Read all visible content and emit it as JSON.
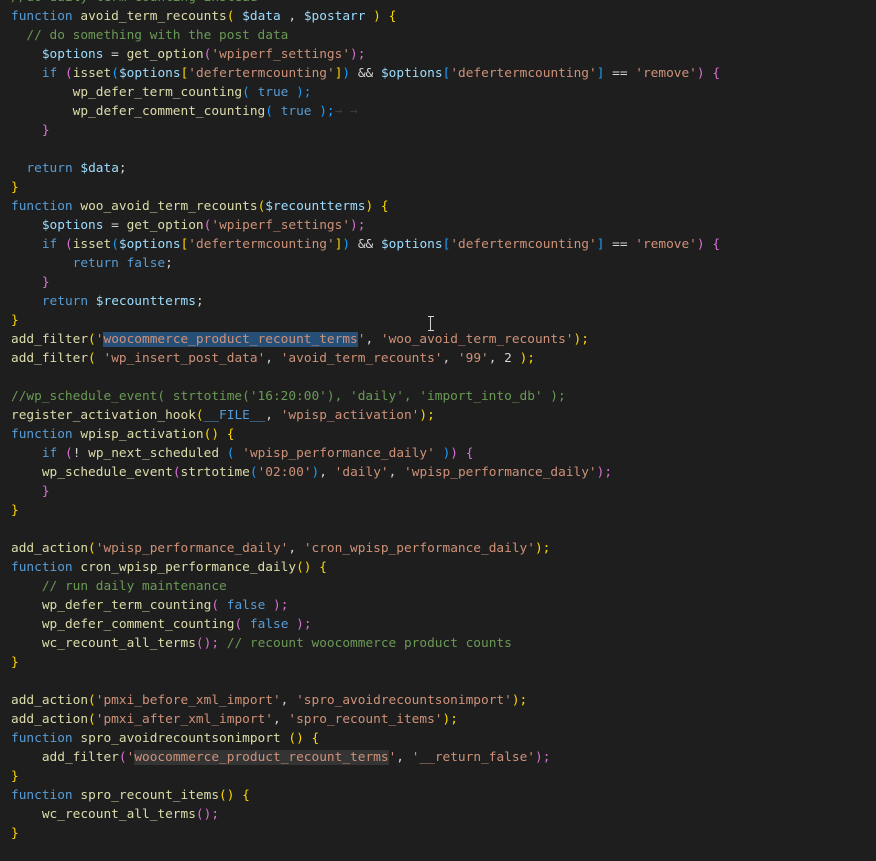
{
  "editor": {
    "colors": {
      "background": "#1e1e1e",
      "keyword": "#569cd6",
      "function": "#dcdcaa",
      "variable": "#9cdcfe",
      "string": "#ce9178",
      "comment": "#6a9955",
      "selection": "#264f78"
    },
    "cursor_icon": "text-cursor-ibeam-icon",
    "lines": [
      [
        {
          "t": "//do daily term counting instead",
          "c": "cm"
        }
      ],
      [
        {
          "t": "function",
          "c": "kw"
        },
        {
          "t": " ",
          "c": "pl"
        },
        {
          "t": "avoid_term_recounts",
          "c": "fn"
        },
        {
          "t": "( ",
          "c": "br"
        },
        {
          "t": "$data",
          "c": "var"
        },
        {
          "t": " , ",
          "c": "pl"
        },
        {
          "t": "$postarr",
          "c": "var"
        },
        {
          "t": " ) ",
          "c": "br"
        },
        {
          "t": "{",
          "c": "br"
        }
      ],
      [
        {
          "t": "  ",
          "c": "ws"
        },
        {
          "t": "// do something with the post data",
          "c": "cm"
        }
      ],
      [
        {
          "t": "    ",
          "c": "ws"
        },
        {
          "t": "$options",
          "c": "var"
        },
        {
          "t": " = ",
          "c": "pl"
        },
        {
          "t": "get_option",
          "c": "fn"
        },
        {
          "t": "(",
          "c": "br2"
        },
        {
          "t": "'wpiperf_settings'",
          "c": "str"
        },
        {
          "t": ");",
          "c": "br2"
        }
      ],
      [
        {
          "t": "    ",
          "c": "ws"
        },
        {
          "t": "if",
          "c": "kw"
        },
        {
          "t": " ",
          "c": "pl"
        },
        {
          "t": "(",
          "c": "br2"
        },
        {
          "t": "isset",
          "c": "fn"
        },
        {
          "t": "(",
          "c": "br3"
        },
        {
          "t": "$options",
          "c": "var"
        },
        {
          "t": "[",
          "c": "br"
        },
        {
          "t": "'defertermcounting'",
          "c": "str"
        },
        {
          "t": "]",
          "c": "br"
        },
        {
          "t": ")",
          "c": "br3"
        },
        {
          "t": " && ",
          "c": "pl"
        },
        {
          "t": "$options",
          "c": "var"
        },
        {
          "t": "[",
          "c": "br3"
        },
        {
          "t": "'defertermcounting'",
          "c": "str"
        },
        {
          "t": "]",
          "c": "br3"
        },
        {
          "t": " == ",
          "c": "pl"
        },
        {
          "t": "'remove'",
          "c": "str"
        },
        {
          "t": ")",
          "c": "br2"
        },
        {
          "t": " {",
          "c": "br2"
        }
      ],
      [
        {
          "t": "        ",
          "c": "ws"
        },
        {
          "t": "wp_defer_term_counting",
          "c": "fn"
        },
        {
          "t": "(",
          "c": "br3"
        },
        {
          "t": " true ",
          "c": "kw"
        },
        {
          "t": ");",
          "c": "br3"
        }
      ],
      [
        {
          "t": "        ",
          "c": "ws"
        },
        {
          "t": "wp_defer_comment_counting",
          "c": "fn"
        },
        {
          "t": "(",
          "c": "br3"
        },
        {
          "t": " true ",
          "c": "kw"
        },
        {
          "t": ");",
          "c": "br3"
        },
        {
          "t": "→ →",
          "c": "ws"
        }
      ],
      [
        {
          "t": "    ",
          "c": "ws"
        },
        {
          "t": "}",
          "c": "br2"
        }
      ],
      [
        {
          "t": " ",
          "c": "pl"
        }
      ],
      [
        {
          "t": "  ",
          "c": "ws"
        },
        {
          "t": "return",
          "c": "kw"
        },
        {
          "t": " ",
          "c": "pl"
        },
        {
          "t": "$data",
          "c": "var"
        },
        {
          "t": ";",
          "c": "pl"
        }
      ],
      [
        {
          "t": "}",
          "c": "br"
        }
      ],
      [
        {
          "t": "function",
          "c": "kw"
        },
        {
          "t": " ",
          "c": "pl"
        },
        {
          "t": "woo_avoid_term_recounts",
          "c": "fn"
        },
        {
          "t": "(",
          "c": "br"
        },
        {
          "t": "$recountterms",
          "c": "var"
        },
        {
          "t": ") ",
          "c": "br"
        },
        {
          "t": "{",
          "c": "br"
        }
      ],
      [
        {
          "t": "    ",
          "c": "ws"
        },
        {
          "t": "$options",
          "c": "var"
        },
        {
          "t": " = ",
          "c": "pl"
        },
        {
          "t": "get_option",
          "c": "fn"
        },
        {
          "t": "(",
          "c": "br2"
        },
        {
          "t": "'wpiperf_settings'",
          "c": "str"
        },
        {
          "t": ");",
          "c": "br2"
        }
      ],
      [
        {
          "t": "    ",
          "c": "ws"
        },
        {
          "t": "if",
          "c": "kw"
        },
        {
          "t": " ",
          "c": "pl"
        },
        {
          "t": "(",
          "c": "br2"
        },
        {
          "t": "isset",
          "c": "fn"
        },
        {
          "t": "(",
          "c": "br3"
        },
        {
          "t": "$options",
          "c": "var"
        },
        {
          "t": "[",
          "c": "br"
        },
        {
          "t": "'defertermcounting'",
          "c": "str"
        },
        {
          "t": "]",
          "c": "br"
        },
        {
          "t": ")",
          "c": "br3"
        },
        {
          "t": " && ",
          "c": "pl"
        },
        {
          "t": "$options",
          "c": "var"
        },
        {
          "t": "[",
          "c": "br3"
        },
        {
          "t": "'defertermcounting'",
          "c": "str"
        },
        {
          "t": "]",
          "c": "br3"
        },
        {
          "t": " == ",
          "c": "pl"
        },
        {
          "t": "'remove'",
          "c": "str"
        },
        {
          "t": ")",
          "c": "br2"
        },
        {
          "t": " {",
          "c": "br2"
        }
      ],
      [
        {
          "t": "        ",
          "c": "ws"
        },
        {
          "t": "return",
          "c": "kw"
        },
        {
          "t": " ",
          "c": "pl"
        },
        {
          "t": "false",
          "c": "kw"
        },
        {
          "t": ";",
          "c": "pl"
        }
      ],
      [
        {
          "t": "    ",
          "c": "ws"
        },
        {
          "t": "}",
          "c": "br2"
        }
      ],
      [
        {
          "t": "    ",
          "c": "ws"
        },
        {
          "t": "return",
          "c": "kw"
        },
        {
          "t": " ",
          "c": "pl"
        },
        {
          "t": "$recountterms",
          "c": "var"
        },
        {
          "t": ";",
          "c": "pl"
        }
      ],
      [
        {
          "t": "}",
          "c": "br"
        }
      ],
      [
        {
          "t": "add_filter",
          "c": "fn"
        },
        {
          "t": "(",
          "c": "br"
        },
        {
          "t": "'",
          "c": "str"
        },
        {
          "t": "woocommerce_product_recount_terms",
          "c": "sel"
        },
        {
          "t": "'",
          "c": "str"
        },
        {
          "t": ", ",
          "c": "pl"
        },
        {
          "t": "'woo_avoid_term_recounts'",
          "c": "str"
        },
        {
          "t": ");",
          "c": "br"
        }
      ],
      [
        {
          "t": "add_filter",
          "c": "fn"
        },
        {
          "t": "(",
          "c": "br"
        },
        {
          "t": " ",
          "c": "pl"
        },
        {
          "t": "'wp_insert_post_data'",
          "c": "str"
        },
        {
          "t": ", ",
          "c": "pl"
        },
        {
          "t": "'avoid_term_recounts'",
          "c": "str"
        },
        {
          "t": ", ",
          "c": "pl"
        },
        {
          "t": "'99'",
          "c": "str"
        },
        {
          "t": ", ",
          "c": "pl"
        },
        {
          "t": "2",
          "c": "pl"
        },
        {
          "t": " );",
          "c": "br"
        }
      ],
      [
        {
          "t": " ",
          "c": "pl"
        }
      ],
      [
        {
          "t": "//wp_schedule_event( strtotime('16:20:00'), 'daily', 'import_into_db' );",
          "c": "cm"
        }
      ],
      [
        {
          "t": "register_activation_hook",
          "c": "fn"
        },
        {
          "t": "(",
          "c": "br"
        },
        {
          "t": "__FILE__",
          "c": "kw"
        },
        {
          "t": ", ",
          "c": "pl"
        },
        {
          "t": "'wpisp_activation'",
          "c": "str"
        },
        {
          "t": ");",
          "c": "br"
        }
      ],
      [
        {
          "t": "function",
          "c": "kw"
        },
        {
          "t": " ",
          "c": "pl"
        },
        {
          "t": "wpisp_activation",
          "c": "fn"
        },
        {
          "t": "() ",
          "c": "br"
        },
        {
          "t": "{",
          "c": "br"
        }
      ],
      [
        {
          "t": "    ",
          "c": "ws"
        },
        {
          "t": "if",
          "c": "kw"
        },
        {
          "t": " ",
          "c": "pl"
        },
        {
          "t": "(",
          "c": "br2"
        },
        {
          "t": "! ",
          "c": "pl"
        },
        {
          "t": "wp_next_scheduled",
          "c": "fn"
        },
        {
          "t": " (",
          "c": "br3"
        },
        {
          "t": " ",
          "c": "pl"
        },
        {
          "t": "'wpisp_performance_daily'",
          "c": "str"
        },
        {
          "t": " )",
          "c": "br3"
        },
        {
          "t": ")",
          "c": "br2"
        },
        {
          "t": " {",
          "c": "br2"
        }
      ],
      [
        {
          "t": "    ",
          "c": "ws"
        },
        {
          "t": "wp_schedule_event",
          "c": "fn"
        },
        {
          "t": "(",
          "c": "br2"
        },
        {
          "t": "strtotime",
          "c": "fn"
        },
        {
          "t": "(",
          "c": "br3"
        },
        {
          "t": "'02:00'",
          "c": "str"
        },
        {
          "t": ")",
          "c": "br3"
        },
        {
          "t": ", ",
          "c": "pl"
        },
        {
          "t": "'daily'",
          "c": "str"
        },
        {
          "t": ", ",
          "c": "pl"
        },
        {
          "t": "'wpisp_performance_daily'",
          "c": "str"
        },
        {
          "t": ");",
          "c": "br2"
        }
      ],
      [
        {
          "t": "    ",
          "c": "ws"
        },
        {
          "t": "}",
          "c": "br2"
        }
      ],
      [
        {
          "t": "}",
          "c": "br"
        }
      ],
      [
        {
          "t": " ",
          "c": "pl"
        }
      ],
      [
        {
          "t": "add_action",
          "c": "fn"
        },
        {
          "t": "(",
          "c": "br"
        },
        {
          "t": "'wpisp_performance_daily'",
          "c": "str"
        },
        {
          "t": ", ",
          "c": "pl"
        },
        {
          "t": "'cron_wpisp_performance_daily'",
          "c": "str"
        },
        {
          "t": ");",
          "c": "br"
        }
      ],
      [
        {
          "t": "function",
          "c": "kw"
        },
        {
          "t": " ",
          "c": "pl"
        },
        {
          "t": "cron_wpisp_performance_daily",
          "c": "fn"
        },
        {
          "t": "() ",
          "c": "br"
        },
        {
          "t": "{",
          "c": "br"
        }
      ],
      [
        {
          "t": "    ",
          "c": "ws"
        },
        {
          "t": "// run daily maintenance",
          "c": "cm"
        }
      ],
      [
        {
          "t": "    ",
          "c": "ws"
        },
        {
          "t": "wp_defer_term_counting",
          "c": "fn"
        },
        {
          "t": "(",
          "c": "br2"
        },
        {
          "t": " false ",
          "c": "kw"
        },
        {
          "t": ");",
          "c": "br2"
        }
      ],
      [
        {
          "t": "    ",
          "c": "ws"
        },
        {
          "t": "wp_defer_comment_counting",
          "c": "fn"
        },
        {
          "t": "(",
          "c": "br2"
        },
        {
          "t": " false ",
          "c": "kw"
        },
        {
          "t": ");",
          "c": "br2"
        }
      ],
      [
        {
          "t": "    ",
          "c": "ws"
        },
        {
          "t": "wc_recount_all_terms",
          "c": "fn"
        },
        {
          "t": "();",
          "c": "br2"
        },
        {
          "t": " ",
          "c": "pl"
        },
        {
          "t": "// recount woocommerce product counts",
          "c": "cm"
        }
      ],
      [
        {
          "t": "}",
          "c": "br"
        }
      ],
      [
        {
          "t": " ",
          "c": "pl"
        }
      ],
      [
        {
          "t": "add_action",
          "c": "fn"
        },
        {
          "t": "(",
          "c": "br"
        },
        {
          "t": "'pmxi_before_xml_import'",
          "c": "str"
        },
        {
          "t": ", ",
          "c": "pl"
        },
        {
          "t": "'spro_avoidrecountsonimport'",
          "c": "str"
        },
        {
          "t": ");",
          "c": "br"
        }
      ],
      [
        {
          "t": "add_action",
          "c": "fn"
        },
        {
          "t": "(",
          "c": "br"
        },
        {
          "t": "'pmxi_after_xml_import'",
          "c": "str"
        },
        {
          "t": ", ",
          "c": "pl"
        },
        {
          "t": "'spro_recount_items'",
          "c": "str"
        },
        {
          "t": ");",
          "c": "br"
        }
      ],
      [
        {
          "t": "function",
          "c": "kw"
        },
        {
          "t": " ",
          "c": "pl"
        },
        {
          "t": "spro_avoidrecountsonimport",
          "c": "fn"
        },
        {
          "t": " () ",
          "c": "br"
        },
        {
          "t": "{",
          "c": "br"
        }
      ],
      [
        {
          "t": "    ",
          "c": "ws"
        },
        {
          "t": "add_filter",
          "c": "fn"
        },
        {
          "t": "(",
          "c": "br2"
        },
        {
          "t": "'",
          "c": "str"
        },
        {
          "t": "woocommerce_product_recount_terms",
          "c": "hl"
        },
        {
          "t": "'",
          "c": "str"
        },
        {
          "t": ", ",
          "c": "pl"
        },
        {
          "t": "'__return_false'",
          "c": "str"
        },
        {
          "t": ");",
          "c": "br2"
        }
      ],
      [
        {
          "t": "}",
          "c": "br"
        }
      ],
      [
        {
          "t": "function",
          "c": "kw"
        },
        {
          "t": " ",
          "c": "pl"
        },
        {
          "t": "spro_recount_items",
          "c": "fn"
        },
        {
          "t": "() ",
          "c": "br"
        },
        {
          "t": "{",
          "c": "br"
        }
      ],
      [
        {
          "t": "    ",
          "c": "ws"
        },
        {
          "t": "wc_recount_all_terms",
          "c": "fn"
        },
        {
          "t": "();",
          "c": "br2"
        }
      ],
      [
        {
          "t": "}",
          "c": "br"
        }
      ]
    ]
  }
}
